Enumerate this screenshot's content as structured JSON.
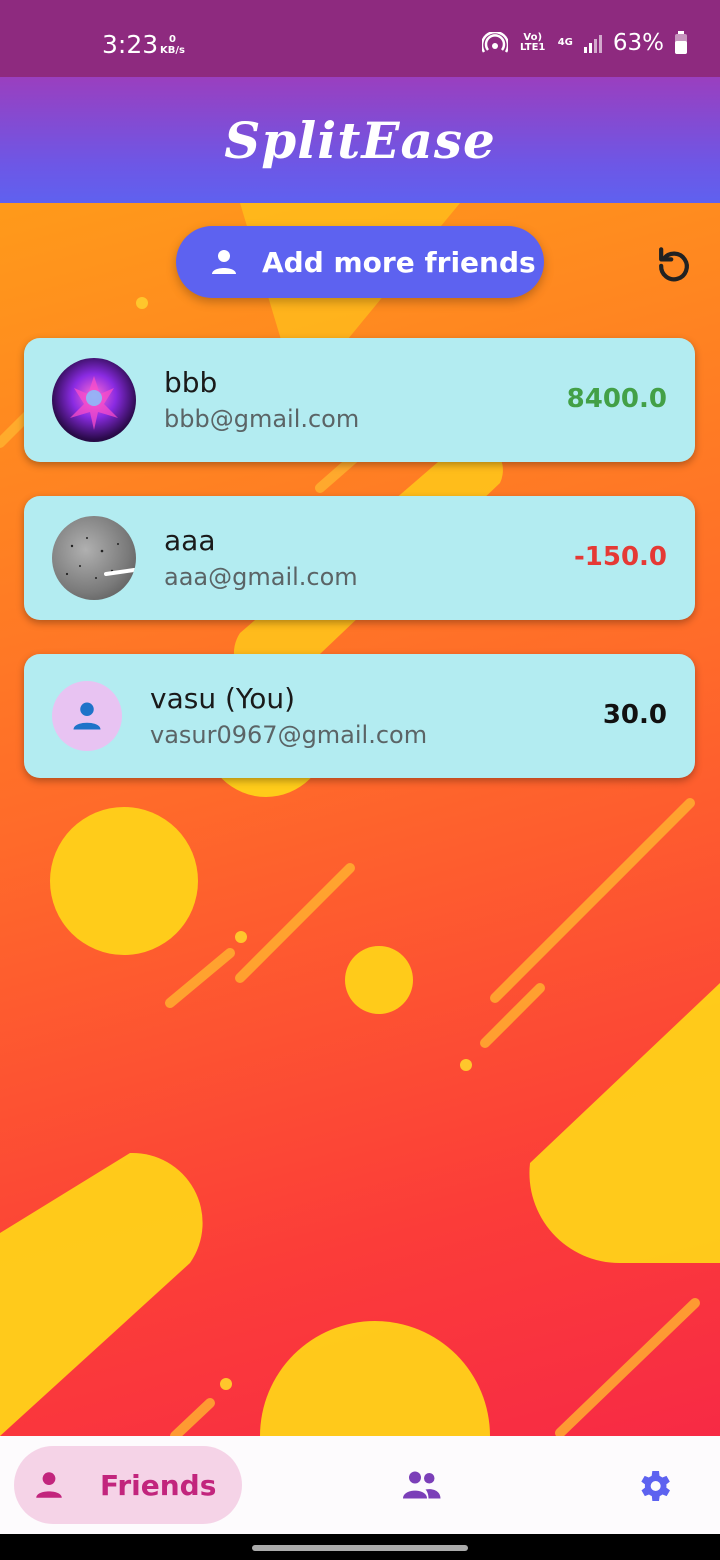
{
  "status_bar": {
    "time": "3:23",
    "net_speed_value": "0",
    "net_speed_unit": "KB/s",
    "signal_text": "Vo) LTE1",
    "network_type": "4G",
    "battery": "63%"
  },
  "app": {
    "title": "SplitEase"
  },
  "actions": {
    "add_friends_label": "Add more friends"
  },
  "friends": [
    {
      "name": "bbb",
      "email": "bbb@gmail.com",
      "amount": "8400.0",
      "amount_color": "#43a047"
    },
    {
      "name": "aaa",
      "email": "aaa@gmail.com",
      "amount": "-150.0",
      "amount_color": "#e53935"
    },
    {
      "name": "vasu (You)",
      "email": "vasur0967@gmail.com",
      "amount": "30.0",
      "amount_color": "#111111"
    }
  ],
  "bottom_nav": {
    "friends_label": "Friends",
    "groups_icon": "groups-icon",
    "settings_icon": "settings-icon"
  },
  "colors": {
    "accent": "#5d62f0",
    "card": "#b3ecf1",
    "nav_active": "#c2257d",
    "nav_icon": "#7b3fb8"
  }
}
